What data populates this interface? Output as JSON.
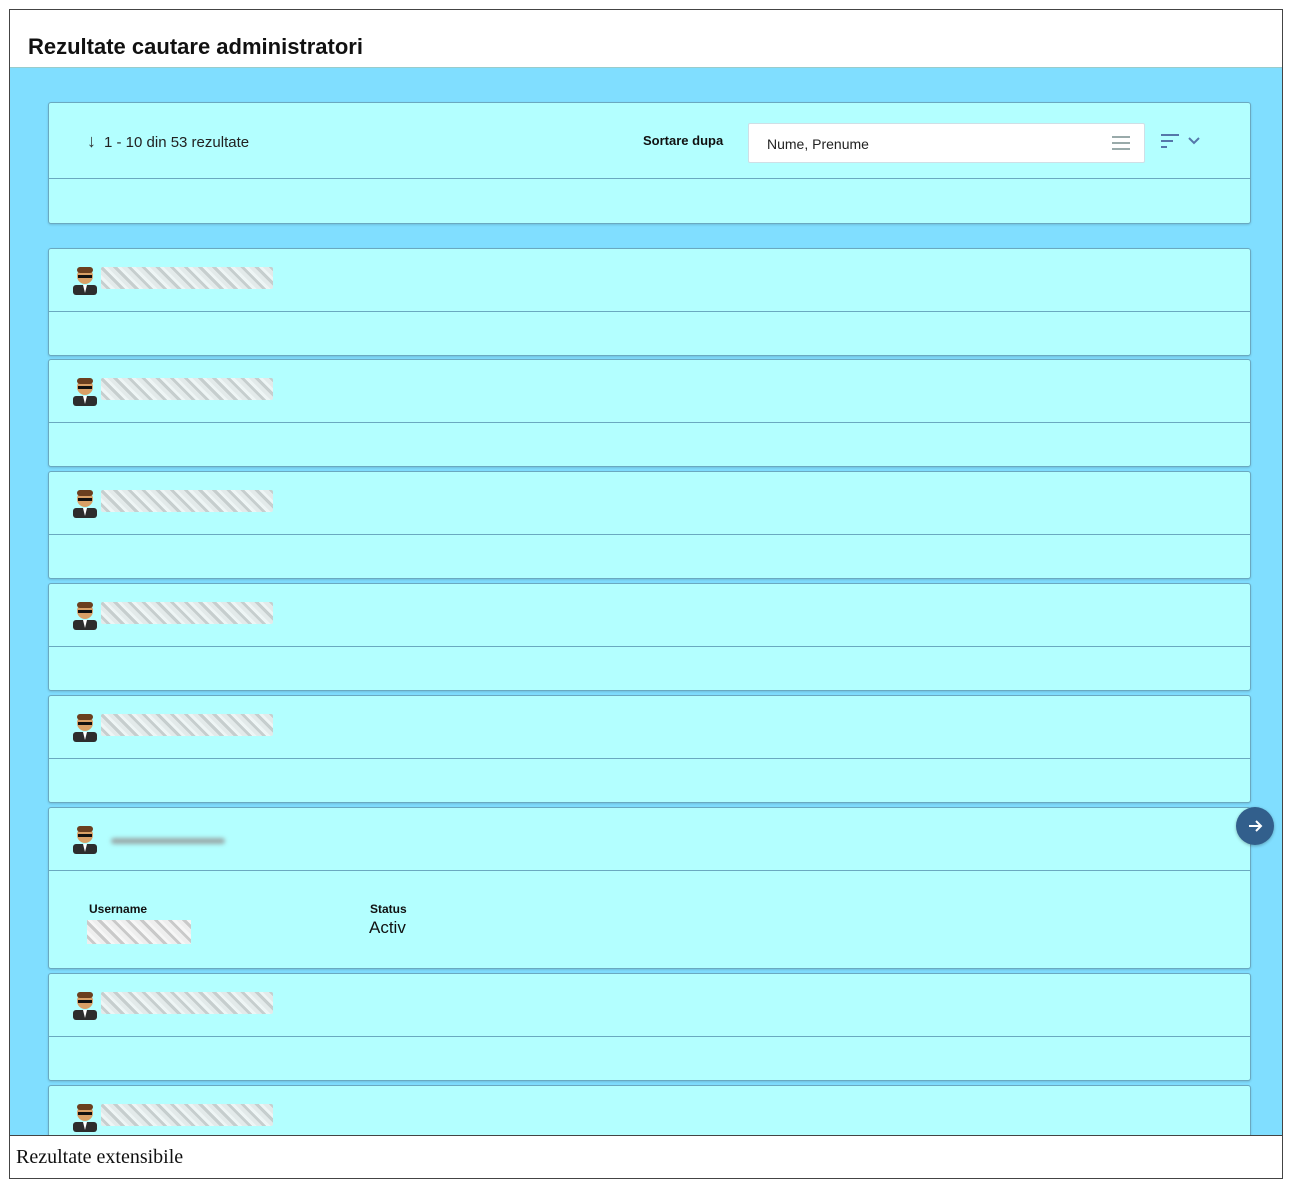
{
  "page": {
    "title": "Rezultate cautare administratori",
    "caption": "Rezultate extensibile"
  },
  "toolbar": {
    "count_text": "1 - 10 din 53 rezultate",
    "count_icon": "arrow-down-icon",
    "sort_label": "Sortare dupa",
    "sort_value": "Nume, Prenume",
    "sort_menu_icon": "menu-lines-icon",
    "sort_order_icon": "sort-descending-icon"
  },
  "results": [
    {
      "expanded": false,
      "name_redacted": true
    },
    {
      "expanded": false,
      "name_redacted": true
    },
    {
      "expanded": false,
      "name_redacted": true
    },
    {
      "expanded": false,
      "name_redacted": true
    },
    {
      "expanded": false,
      "name_redacted": true
    },
    {
      "expanded": true,
      "name_redacted": true,
      "fields": {
        "username_label": "Username",
        "status_label": "Status",
        "status_value": "Activ"
      }
    },
    {
      "expanded": false,
      "name_redacted": true
    },
    {
      "expanded": false,
      "name_redacted": true
    }
  ],
  "actions": {
    "next_icon": "arrow-right-icon"
  },
  "colors": {
    "background": "#80deff",
    "card": "#b3ffff",
    "border": "#6aa9c0",
    "button": "#325f8c"
  }
}
